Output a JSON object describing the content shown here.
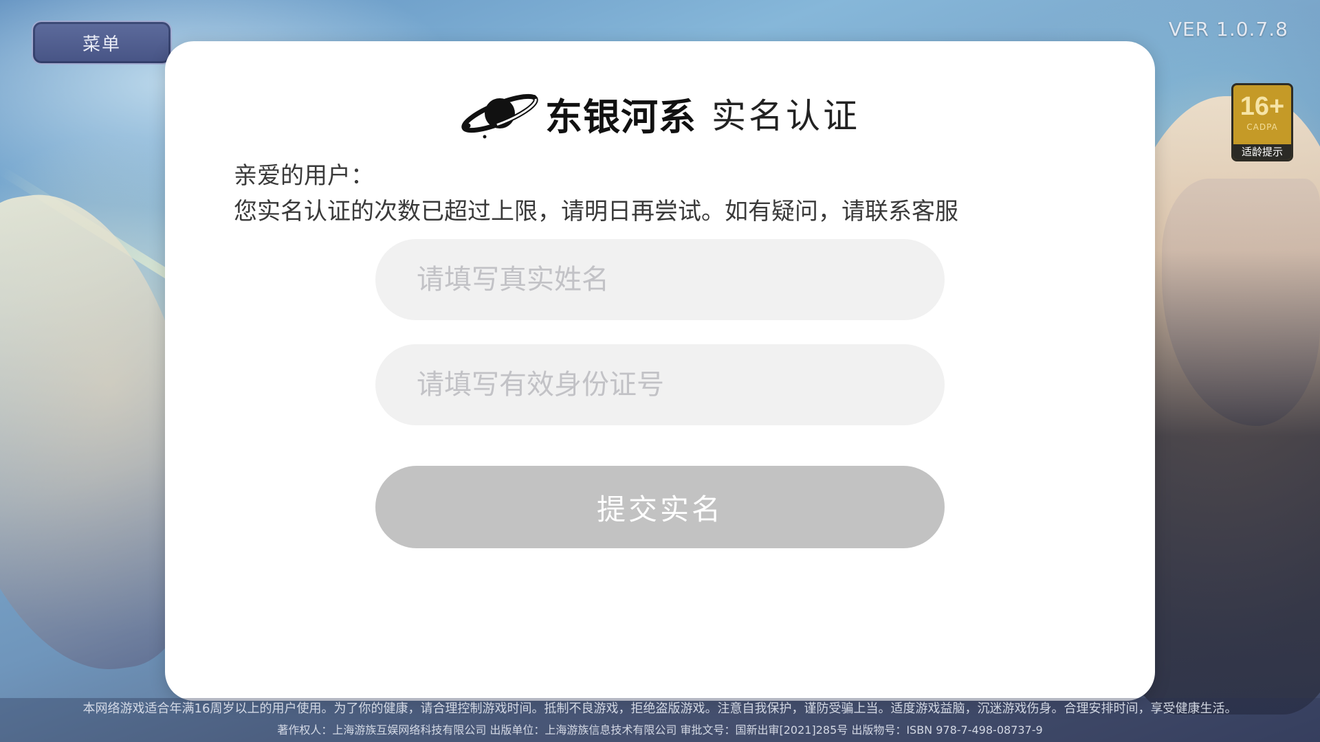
{
  "app": {
    "menu_label": "菜单",
    "version": "VER 1.0.7.8"
  },
  "age_rating": {
    "rating": "16+",
    "org": "CADPA",
    "tip": "适龄提示"
  },
  "dialog": {
    "brand_name": "东银河系",
    "title": "实名认证",
    "greeting": "亲爱的用户：",
    "message": "您实名认证的次数已超过上限，请明日再尝试。如有疑问，请联系客服",
    "name_field": {
      "placeholder": "请填写真实姓名",
      "value": ""
    },
    "id_field": {
      "placeholder": "请填写有效身份证号",
      "value": ""
    },
    "submit_label": "提交实名",
    "submit_color": "#c2c2c2"
  },
  "footer": {
    "notice": "本网络游戏适合年满16周岁以上的用户使用。为了你的健康，请合理控制游戏时间。抵制不良游戏，拒绝盗版游戏。注意自我保护，谨防受骗上当。适度游戏益脑，沉迷游戏伤身。合理安排时间，享受健康生活。",
    "credits": "著作权人：上海游族互娱网络科技有限公司 出版单位：上海游族信息技术有限公司 审批文号：国新出审[2021]285号 出版物号：ISBN 978-7-498-08737-9"
  },
  "icons": {
    "brand_logo": "planet-ring-icon"
  }
}
